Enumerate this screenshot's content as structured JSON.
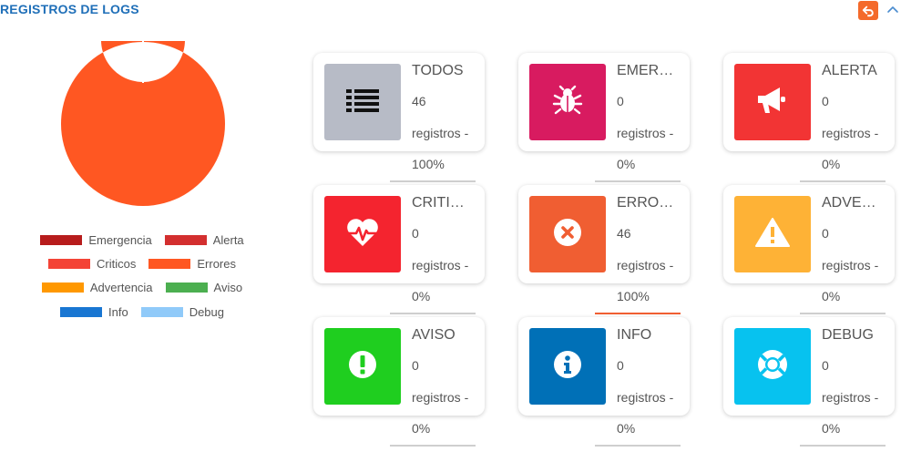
{
  "header": {
    "title": "REGISTROS DE LOGS",
    "undo_icon": "undo-icon",
    "collapse_icon": "chevron-up-icon"
  },
  "chart_data": {
    "type": "pie",
    "donut": true,
    "categories": [
      "Emergencia",
      "Alerta",
      "Criticos",
      "Errores",
      "Advertencia",
      "Aviso",
      "Info",
      "Debug"
    ],
    "values": [
      0,
      0,
      0,
      46,
      0,
      0,
      0,
      0
    ],
    "colors": [
      "#b71c1c",
      "#d32f2f",
      "#f44336",
      "#ff5722",
      "#ff9800",
      "#4caf50",
      "#1976d2",
      "#90caf9"
    ],
    "legend_position": "bottom"
  },
  "legend": [
    [
      {
        "label": "Emergencia",
        "color": "#b71c1c"
      },
      {
        "label": "Alerta",
        "color": "#d32f2f"
      }
    ],
    [
      {
        "label": "Criticos",
        "color": "#f44336"
      },
      {
        "label": "Errores",
        "color": "#ff5722"
      }
    ],
    [
      {
        "label": "Advertencia",
        "color": "#ff9800"
      },
      {
        "label": "Aviso",
        "color": "#4caf50"
      }
    ],
    [
      {
        "label": "Info",
        "color": "#1976d2"
      },
      {
        "label": "Debug",
        "color": "#90caf9"
      }
    ]
  ],
  "cards": [
    {
      "title": "TODOS",
      "count": "46",
      "sub": "registros -",
      "percent": "100%",
      "color": "#b7bbc6",
      "icon": "list-icon",
      "line_color": "#cfcfcf"
    },
    {
      "title": "EMER…",
      "count": "0",
      "sub": "registros -",
      "percent": "0%",
      "color": "#d81b60",
      "icon": "bug-icon",
      "line_color": "#cfcfcf"
    },
    {
      "title": "ALERTA",
      "count": "0",
      "sub": "registros -",
      "percent": "0%",
      "color": "#f23434",
      "icon": "bullhorn-icon",
      "line_color": "#cfcfcf"
    },
    {
      "title": "CRITI…",
      "count": "0",
      "sub": "registros -",
      "percent": "0%",
      "color": "#f4242f",
      "icon": "heartbeat-icon",
      "line_color": "#cfcfcf"
    },
    {
      "title": "ERRO…",
      "count": "46",
      "sub": "registros -",
      "percent": "100%",
      "color": "#f05e32",
      "icon": "times-circle-icon",
      "line_color": "#f05e32"
    },
    {
      "title": "ADVE…",
      "count": "0",
      "sub": "registros -",
      "percent": "0%",
      "color": "#feb236",
      "icon": "warning-icon",
      "line_color": "#cfcfcf"
    },
    {
      "title": "AVISO",
      "count": "0",
      "sub": "registros -",
      "percent": "0%",
      "color": "#1fce1f",
      "icon": "exclamation-circle-icon",
      "line_color": "#cfcfcf"
    },
    {
      "title": "INFO",
      "count": "0",
      "sub": "registros -",
      "percent": "0%",
      "color": "#0070b7",
      "icon": "info-circle-icon",
      "line_color": "#cfcfcf"
    },
    {
      "title": "DEBUG",
      "count": "0",
      "sub": "registros -",
      "percent": "0%",
      "color": "#07c2ef",
      "icon": "life-ring-icon",
      "line_color": "#cfcfcf"
    }
  ]
}
